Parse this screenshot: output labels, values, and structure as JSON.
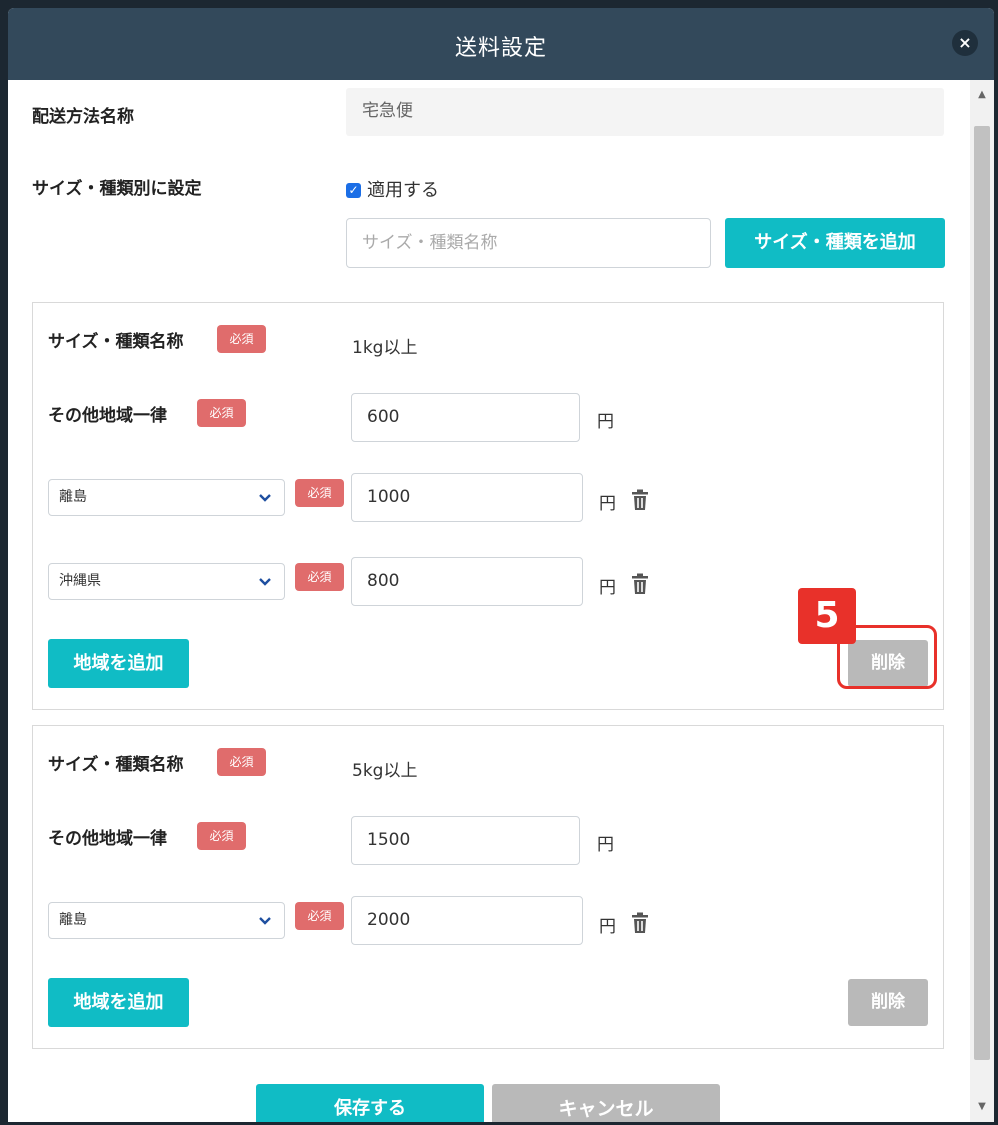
{
  "modal": {
    "title": "送料設定",
    "close_label": "×"
  },
  "shipping_method": {
    "label": "配送方法名称",
    "value": "宅急便"
  },
  "size_setting": {
    "label": "サイズ・種類別に設定",
    "checkbox_label": "適用する",
    "checked": true,
    "name_placeholder": "サイズ・種類名称",
    "add_button": "サイズ・種類を追加"
  },
  "common": {
    "size_name_label": "サイズ・種類名称",
    "other_region_label": "その他地域一律",
    "required_badge": "必須",
    "yen": "円",
    "add_region_button": "地域を追加",
    "delete_button": "削除"
  },
  "cards": [
    {
      "size_name": "1kg以上",
      "other_region_price": "600",
      "regions": [
        {
          "region": "離島",
          "price": "1000"
        },
        {
          "region": "沖縄県",
          "price": "800"
        }
      ]
    },
    {
      "size_name": "5kg以上",
      "other_region_price": "1500",
      "regions": [
        {
          "region": "離島",
          "price": "2000"
        }
      ]
    }
  ],
  "footer": {
    "save_button": "保存する",
    "cancel_button": "キャンセル"
  },
  "callout": {
    "number": "5"
  },
  "colors": {
    "header": "#33495b",
    "teal": "#10bcc5",
    "required": "#e06c6c",
    "callout": "#e8312a",
    "disabled": "#b9b9b9"
  }
}
